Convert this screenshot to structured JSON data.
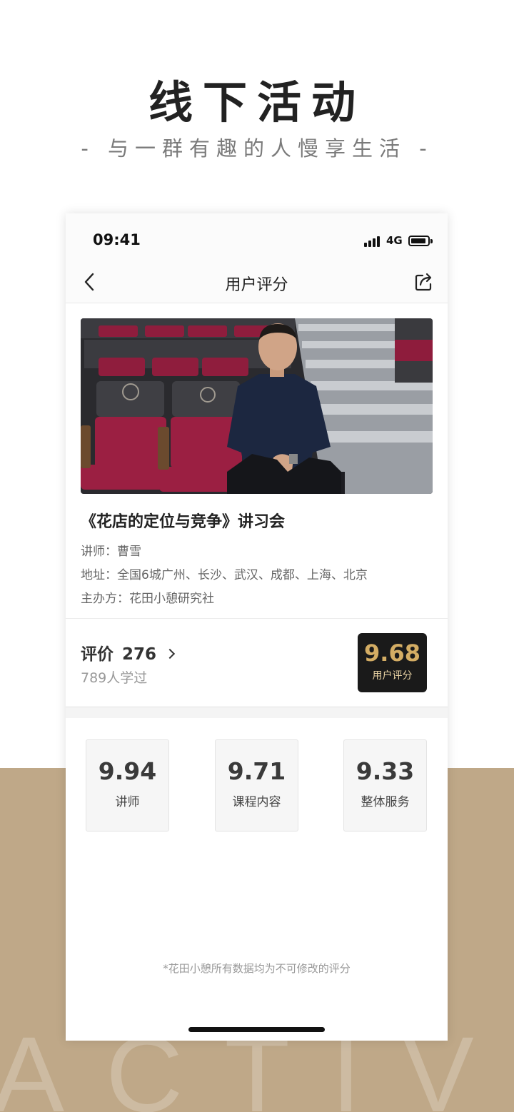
{
  "promo": {
    "headline": "线下活动",
    "subline": "- 与一群有趣的人慢享生活 -",
    "background_word": "ACTIVIT"
  },
  "status_bar": {
    "time": "09:41",
    "network": "4G",
    "icons": [
      "signal-icon",
      "battery-icon"
    ]
  },
  "navbar": {
    "title": "用户评分",
    "back_icon": "chevron-left-icon",
    "share_icon": "share-icon"
  },
  "course": {
    "title": "《花店的定位与竞争》讲习会",
    "lecturer": "讲师：曹雪",
    "address": "地址：全国6城广州、长沙、武汉、成都、上海、北京",
    "organizer": "主办方：花田小憩研究社"
  },
  "reviews": {
    "label": "评价",
    "count": "276",
    "learned": "789人学过",
    "overall_score": "9.68",
    "overall_label": "用户评分"
  },
  "sub_scores": [
    {
      "score": "9.94",
      "label": "讲师"
    },
    {
      "score": "9.71",
      "label": "课程内容"
    },
    {
      "score": "9.33",
      "label": "整体服务"
    }
  ],
  "footnote": "*花田小憩所有数据均为不可修改的评分",
  "colors": {
    "accent_gold": "#d4ad64",
    "badge_bg": "#1a1a1a",
    "band_beige": "#bfa888"
  }
}
